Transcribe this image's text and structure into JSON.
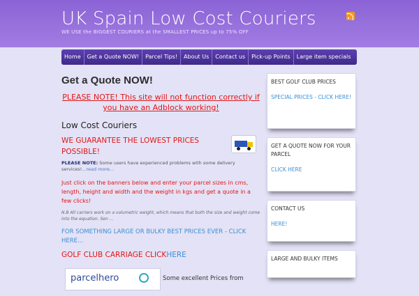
{
  "header": {
    "title": "UK Spain Low Cost Couriers",
    "tagline": "WE USE the BIGGEST COURIERS at the SMALLEST PRICES up to 75% OFF",
    "rss_icon": "rss-icon",
    "colors": {
      "band": "#9370db",
      "nav": "#4b3397",
      "accent_red": "#e01616",
      "link_blue": "#3a8fd4"
    }
  },
  "nav": {
    "items": [
      "Home",
      "Get a Quote NOW!",
      "Parcel Tips!",
      "About Us",
      "Contact us",
      "Pick-up Points",
      "Large item specials"
    ]
  },
  "main": {
    "page_title": "Get a Quote NOW!",
    "adblock_warning": "PLEASE NOTE! This site will not function correctly if you have an Adblock working!",
    "section_title": "Low Cost Couriers",
    "guarantee": "WE GUARANTEE THE LOWEST PRICES POSSIBLE!",
    "note_label": "PLEASE NOTE:",
    "note_text": " Some users have experienced problems with some delivery services!",
    "note_more": "...read more...",
    "instructions": "Just click on the banners below and enter your parcel sizes in cms, length, height and width and the weight in kgs and get a quote in a few clicks!",
    "volumetric_note": "N.B All carriers work on a volumetric weight, which means that both the size and weight come into the equation. Sen ...",
    "large_link": "FOR SOMETHING LARGE OR BULKY BEST PRICES EVER - CLICK HERE...",
    "golf_text": "GOLF CLUB CARRIAGE CLICK",
    "golf_link": "HERE",
    "parcelhero_label": "parcelhero",
    "excellent_text": "Some excellent Prices from"
  },
  "sidebar": {
    "widgets": [
      {
        "title": "BEST GOLF CLUB PRICES",
        "link": "SPECIAL PRICES - CLICK HERE!"
      },
      {
        "title": "GET A QUOTE NOW FOR YOUR PARCEL",
        "link": "CLICK HERE"
      },
      {
        "title": "CONTACT US",
        "link": "HERE!"
      },
      {
        "title": "LARGE AND BULKY ITEMS",
        "link": ""
      }
    ]
  }
}
